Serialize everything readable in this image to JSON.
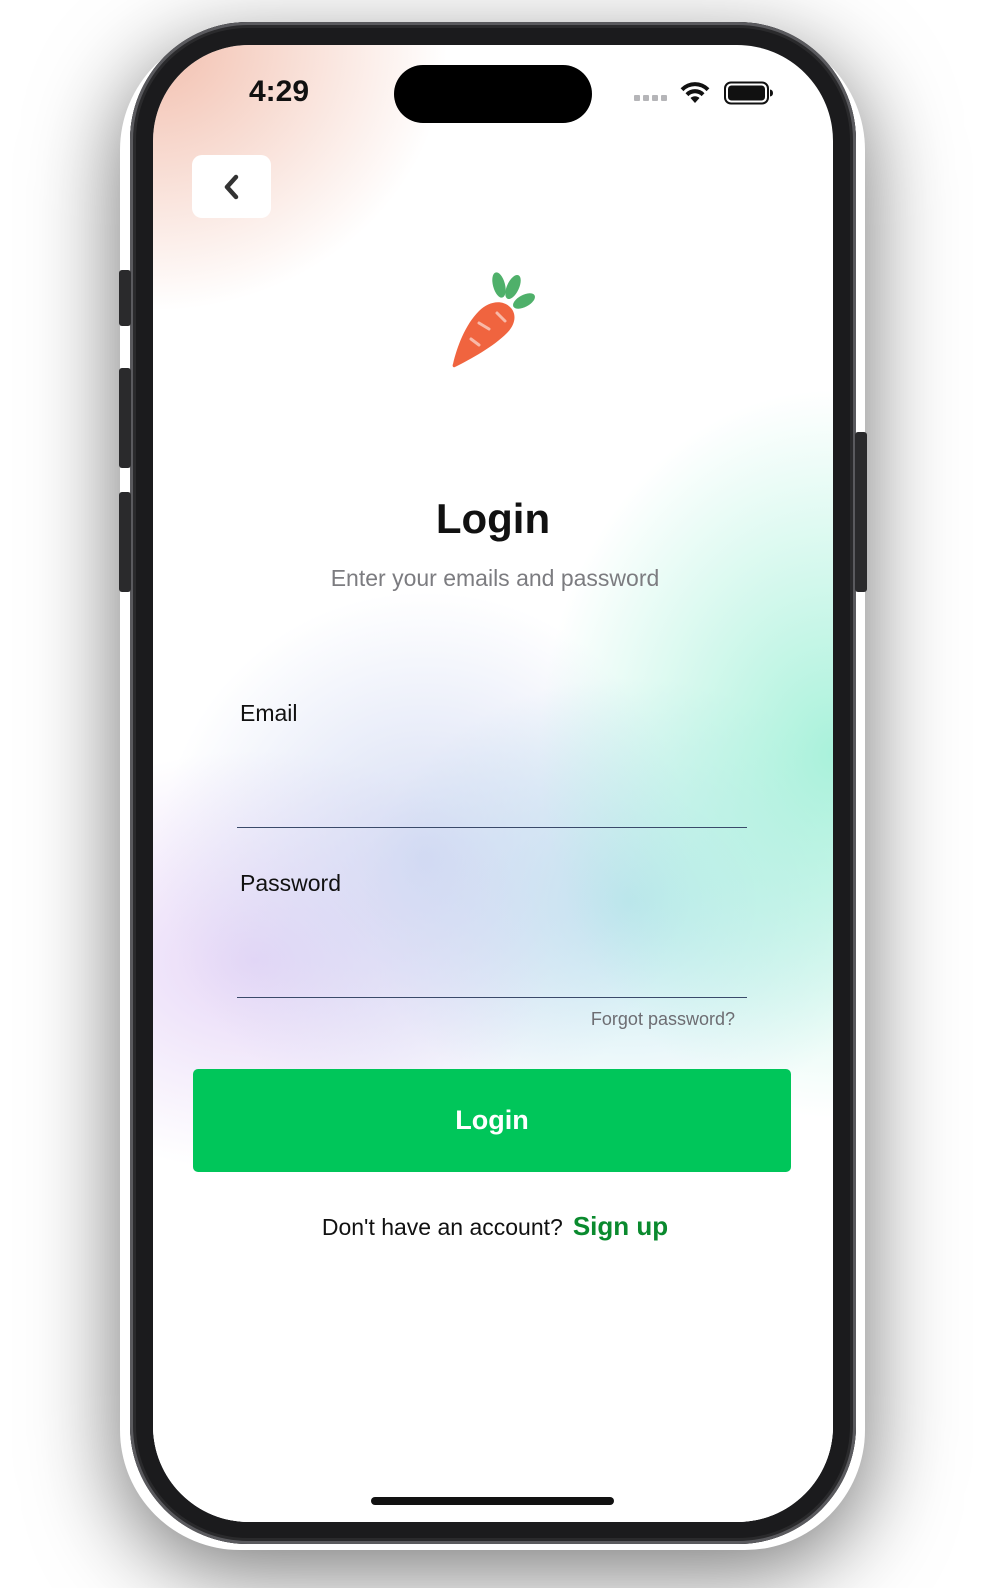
{
  "status_bar": {
    "time": "4:29"
  },
  "back_button": {
    "icon": "chevron-left-icon"
  },
  "logo": {
    "icon": "carrot-icon",
    "colors": {
      "body": "#f0643f",
      "leaves": "#4fb06a"
    }
  },
  "header": {
    "title": "Login",
    "subtitle": "Enter your emails and password"
  },
  "form": {
    "email_label": "Email",
    "email_value": "",
    "password_label": "Password",
    "password_value": "",
    "forgot_password": "Forgot password?"
  },
  "actions": {
    "login_label": "Login",
    "signup_prompt": "Don't have an account?",
    "signup_link": "Sign up"
  },
  "colors": {
    "primary": "#00c65a",
    "link": "#0a8a2e"
  }
}
